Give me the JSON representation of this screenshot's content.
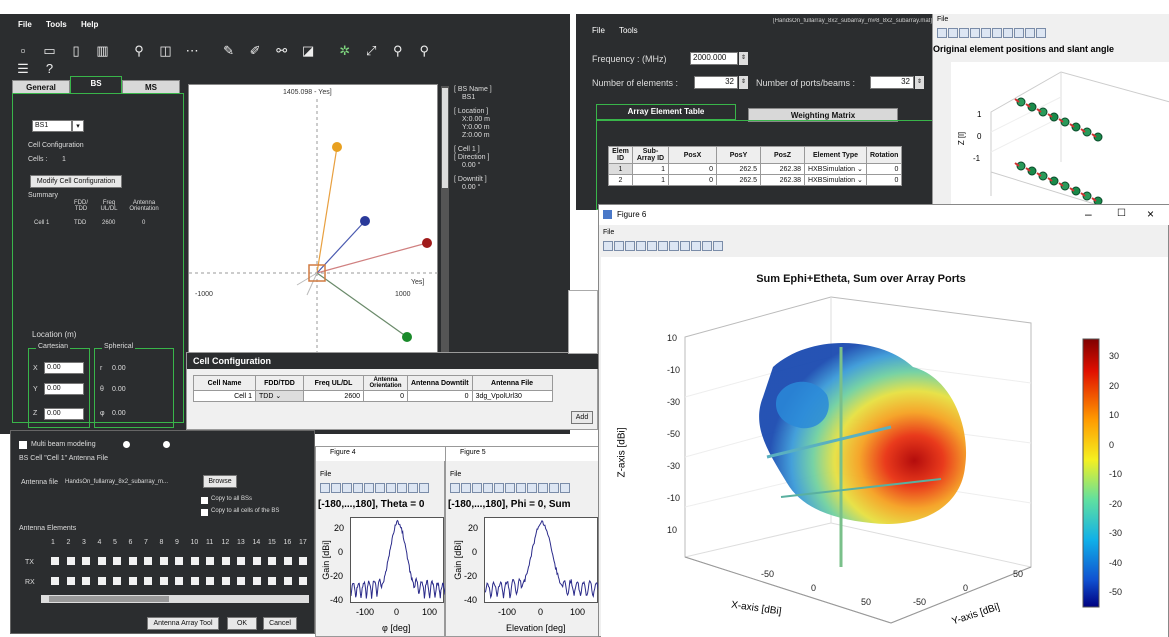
{
  "main_window": {
    "menu": [
      "File",
      "Tools",
      "Help"
    ],
    "tabs": [
      "General",
      "BS",
      "MS"
    ],
    "bs_select": "BS1",
    "cell_configuration_label": "Cell Configuration",
    "cells_label": "Cells :",
    "cells_value": "1",
    "modify_button": "Modify Cell Configuration",
    "summary_label": "Summary",
    "summary_headers": [
      "FDD/ TDD",
      "Freq UL/DL",
      "Antenna Orientation"
    ],
    "summary_row": [
      "Cell 1",
      "TDD",
      "2600",
      "0"
    ],
    "location_label": "Location (m)",
    "cartesian_label": "Cartesian",
    "spherical_label": "Spherical",
    "x_label": "X",
    "x_value": "0.00",
    "y_label": "Y",
    "y_value": "0.00",
    "z_label": "Z",
    "z_value": "0.00",
    "r_label": "r",
    "r_value": "0.00",
    "theta_label": "θ",
    "theta_value": "0.00",
    "phi_label": "φ",
    "phi_value": "0.00",
    "plot_top_label": "1405.098 - Yes]",
    "plot_x_left": "-1000",
    "plot_x_right": "1000",
    "plot_x_label": "Yes]",
    "info_panel": [
      "[ BS Name ]",
      "BS1",
      "[ Location ]",
      "X:0.00 m",
      "Y:0.00 m",
      "Z:0.00 m",
      "[ Cell 1 ]",
      "[ Direction ]",
      "0.00 °",
      "[ Downtilt ]",
      "0.00 °"
    ]
  },
  "cell_config": {
    "title": "Cell Configuration",
    "headers": [
      "Cell Name",
      "FDD/TDD",
      "Freq UL/DL",
      "Antenna Orientation",
      "Antenna Downtilt",
      "Antenna File"
    ],
    "row": [
      "Cell 1",
      "TDD",
      "2600",
      "0",
      "0",
      "3dg_VpolUrl30"
    ],
    "add_button": "Add"
  },
  "antenna_dialog": {
    "multibeam_label": "Multi beam modeling",
    "group_label": "BS Cell \"Cell 1\" Antenna File",
    "antenna_file_label": "Antenna file",
    "antenna_file_value": "HandsOn_fullarray_8x2_subarray_m...",
    "browse_button": "Browse",
    "copy_all_bs": "Copy to all BSs",
    "copy_all_cells": "Copy to all cells of the BS",
    "elements_label": "Antenna Elements",
    "element_numbers": [
      "1",
      "2",
      "3",
      "4",
      "5",
      "6",
      "7",
      "8",
      "9",
      "10",
      "11",
      "12",
      "13",
      "14",
      "15",
      "16",
      "17"
    ],
    "row_tx": "TX",
    "row_rx": "RX",
    "antenna_array_tool_button": "Antenna Array Tool",
    "ok_button": "OK",
    "cancel_button": "Cancel"
  },
  "array_tool": {
    "menu": [
      "File",
      "Tools"
    ],
    "title": "[HandsOn_fullarray_8x2_subarray_m#8_8x2_subarray.mat]",
    "frequency_label": "Frequency : (MHz)",
    "frequency_value": "2000.000",
    "elements_label": "Number of elements :",
    "elements_value": "32",
    "ports_label": "Number of ports/beams :",
    "ports_value": "32",
    "tabs": [
      "Array Element Table",
      "Weighting Matrix"
    ],
    "table_headers": [
      "Elem ID",
      "Sub-Array ID",
      "PosX",
      "PosY",
      "PosZ",
      "Element Type",
      "Rotation"
    ],
    "table_rows": [
      [
        "1",
        "1",
        "0",
        "262.5",
        "262.38",
        "HXBSimulation",
        "0"
      ],
      [
        "2",
        "1",
        "0",
        "262.5",
        "262.38",
        "HXBSimulation",
        "0"
      ]
    ]
  },
  "figure_positions": {
    "menu": "File",
    "title": "Original element positions and slant angle",
    "z_label": "Z [l]",
    "z_ticks": [
      "1",
      "0",
      "-1"
    ]
  },
  "figure_4": {
    "title": "Figure 4",
    "menu": "File",
    "plot_title": "[-180,...,180], Theta = 0",
    "ylabel": "Gain [dBi]",
    "yticks": [
      "20",
      "0",
      "-20",
      "-40"
    ],
    "xticks": [
      "-100",
      "0",
      "100"
    ],
    "xlabel": "φ [deg]"
  },
  "figure_5": {
    "title": "Figure 5",
    "menu": "File",
    "plot_title": "[-180,...,180], Phi = 0, Sum",
    "ylabel": "Gain [dBi]",
    "yticks": [
      "20",
      "0",
      "-20",
      "-40"
    ],
    "xticks": [
      "-100",
      "0",
      "100"
    ],
    "xlabel": "Elevation [deg]"
  },
  "figure_6": {
    "title": "Figure 6",
    "menu": "File",
    "plot_title": "Sum Ephi+Etheta, Sum over Array Ports",
    "zlabel": "Z-axis [dBi]",
    "xlabel": "X-axis [dBi]",
    "ylabel": "Y-axis [dBi]",
    "zticks": [
      "10",
      "-10",
      "-30",
      "-50",
      "-30",
      "-10",
      "10"
    ],
    "xticks": [
      "-50",
      "0",
      "50"
    ],
    "yticks": [
      "-50",
      "0",
      "50"
    ],
    "colorbar_ticks": [
      "30",
      "20",
      "10",
      "0",
      "-10",
      "-20",
      "-30",
      "-40",
      "-50"
    ],
    "colorbar_range": [
      -50,
      38
    ]
  },
  "colors": {
    "dark_bg": "#2b2d2f",
    "accent_green": "#39b54a",
    "matlab_bg": "#f0f0f0"
  }
}
